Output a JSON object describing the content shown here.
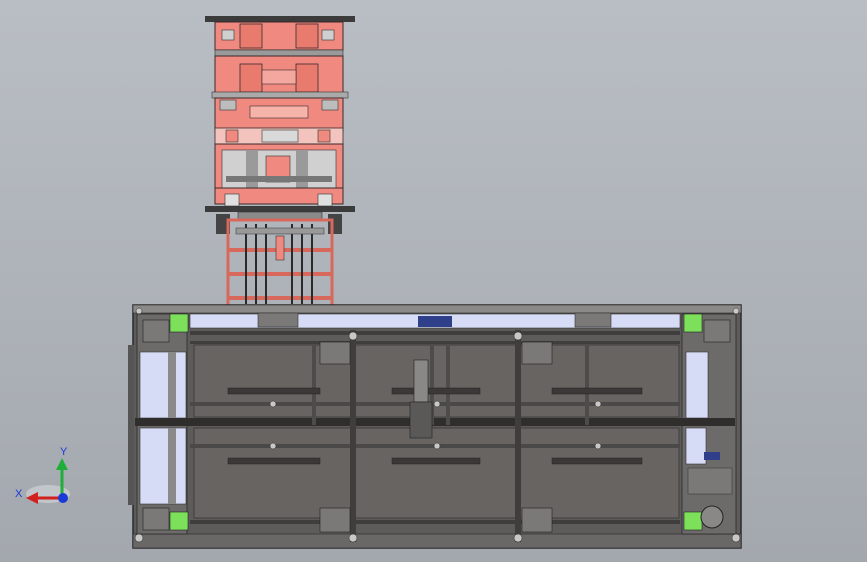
{
  "scene": {
    "background_top": "#b9bec4",
    "background_bottom": "#a3a8ae",
    "frame_color": "#5e5c5a",
    "panel_color": "#676461",
    "red_part_color": "#f08a80",
    "green_part_color": "#7de05a",
    "highlight_color": "#d6dcf5"
  },
  "triad": {
    "x_label": "X",
    "y_label": "Y",
    "x_color": "#d12020",
    "y_color": "#1fae3a",
    "z_color": "#1a3ad8"
  }
}
